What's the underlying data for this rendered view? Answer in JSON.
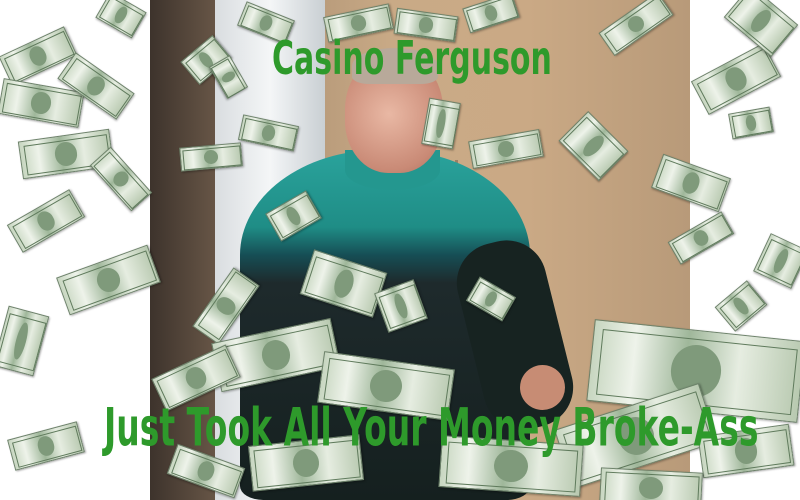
{
  "captions": {
    "top": "Casino Ferguson",
    "bottom": "Just Took All Your Money Broke-Ass"
  },
  "colors": {
    "caption_text": "#2e9a2b",
    "background": "#ffffff",
    "shirt_teal": "#2aa39c",
    "bill_green": "#9fb79a"
  }
}
